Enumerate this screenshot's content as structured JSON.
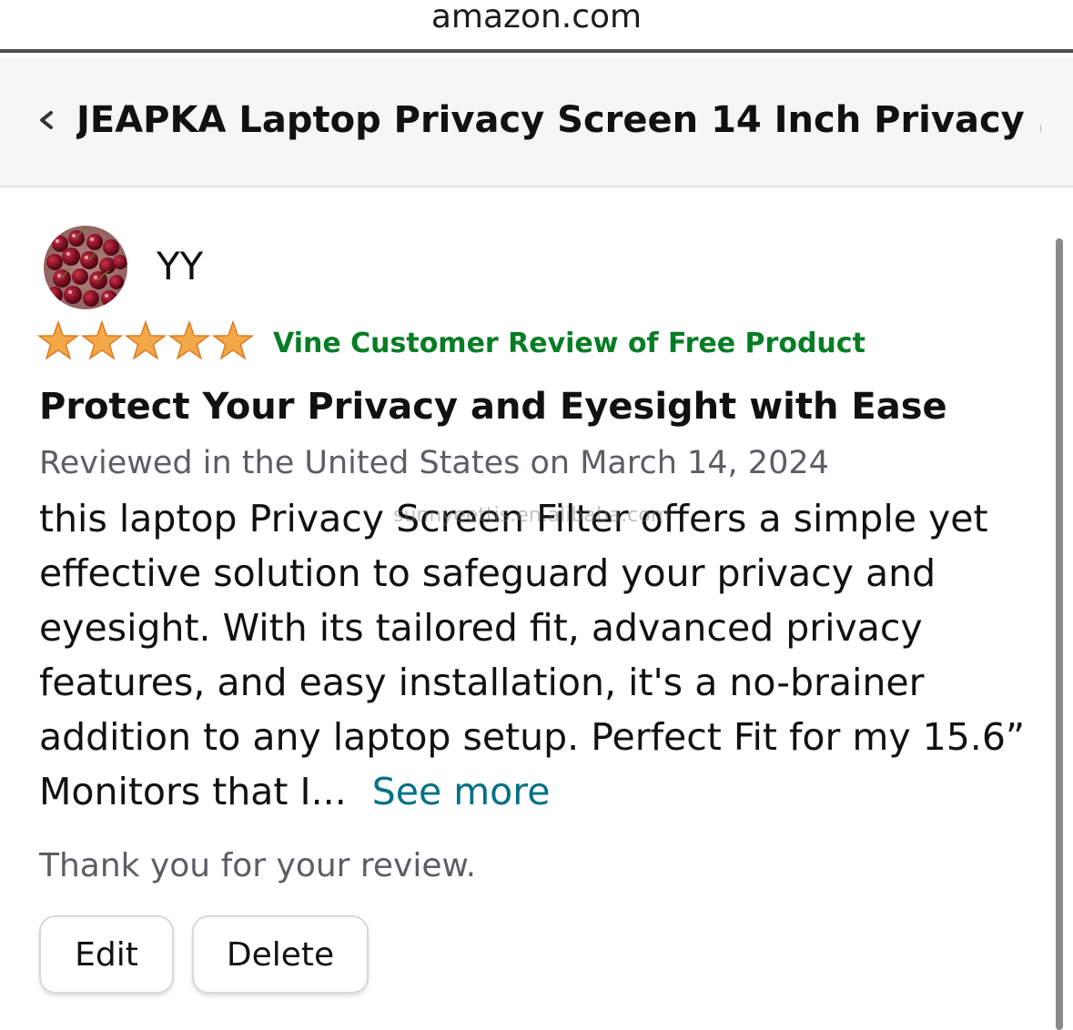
{
  "browser": {
    "url": "amazon.com"
  },
  "header": {
    "back_icon": "chevron-left-icon",
    "product_title": "JEAPKA Laptop Privacy Screen 14 Inch Privacy ..."
  },
  "review": {
    "reviewer_name": "YY",
    "rating": 5,
    "rating_max": 5,
    "star_color": "#f3a847",
    "badge": "Vine Customer Review of Free Product",
    "badge_color": "#067d25",
    "title": "Protect Your Privacy and Eyesight with Ease",
    "date_line": "Reviewed in the United States on March 14, 2024",
    "body_lines": [
      "this laptop Privacy Screen Filter offers a simple yet",
      "effective solution to safeguard your privacy and",
      "eyesight. With its tailored fit, advanced privacy",
      "features, and easy installation, it's a no-brainer",
      "addition to any laptop setup. Perfect Fit for my 15.6”",
      "Monitors that I..."
    ],
    "see_more": "See more",
    "see_more_color": "#007185",
    "watermark": "sunnyeettis.en.alibaba.com"
  },
  "footer": {
    "thanks": "Thank you for your review.",
    "edit_label": "Edit",
    "delete_label": "Delete"
  }
}
